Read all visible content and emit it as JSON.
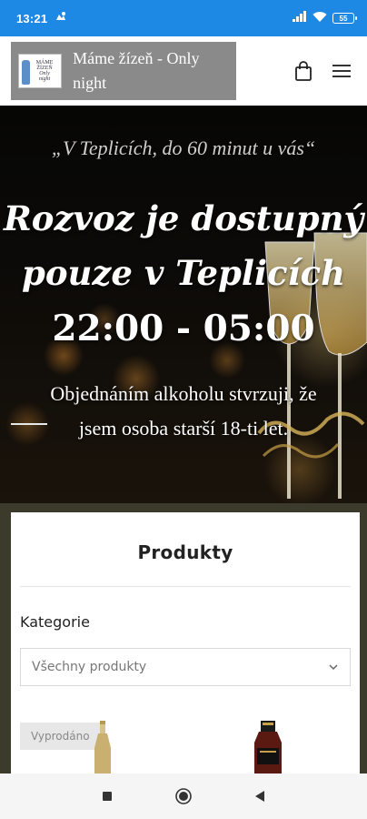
{
  "status_bar": {
    "time": "13:21",
    "battery": "55",
    "icons": [
      "notification-icon",
      "signal-icon",
      "wifi-icon",
      "battery-icon"
    ]
  },
  "header": {
    "logo_lines": [
      "MÁME",
      "ŽÍZEŇ",
      "Only",
      "night"
    ],
    "title": "Máme žízeň - Only night",
    "cart_icon": "shopping-bag-icon",
    "menu_icon": "hamburger-menu-icon",
    "brand_bg": "#8a8a8a"
  },
  "hero": {
    "quote": "„V Teplicích, do 60 minut u vás“",
    "headline": "Rozvoz je dostupný pouze v Teplicích",
    "hours": "22:00 - 05:00",
    "notice": "Objednáním alkoholu stvrzuji, že jsem osoba starší 18-ti let."
  },
  "products": {
    "title": "Produkty",
    "category_label": "Kategorie",
    "category_select": {
      "selected": "Všechny produkty"
    },
    "items": [
      {
        "badge": "Vyprodáno"
      }
    ]
  },
  "nav_bar": {
    "buttons": [
      "recents-square-icon",
      "home-circle-icon",
      "back-triangle-icon"
    ]
  },
  "colors": {
    "status_bar": "#1e88e5",
    "olive_band": "#3b3a2b",
    "hero_bg": "#0d0b08"
  }
}
